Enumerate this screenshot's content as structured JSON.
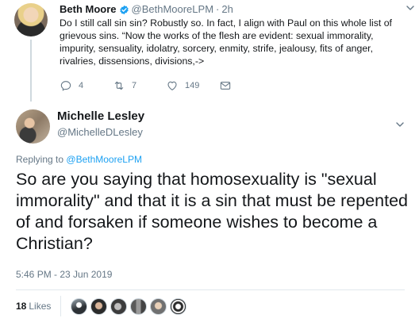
{
  "parent_tweet": {
    "author_name": "Beth Moore",
    "author_handle": "@BethMooreLPM",
    "separator": "·",
    "time": "2h",
    "text": "Do I still call sin sin? Robustly so. In fact, I align with Paul on this whole list of grievous sins. “Now the works of the flesh are evident: sexual immorality, impurity, sensuality, idolatry, sorcery, enmity, strife, jealousy, fits of anger, rivalries, dissensions, divisions,->",
    "actions": {
      "replies": "4",
      "retweets": "7",
      "likes": "149"
    }
  },
  "main_tweet": {
    "author_name": "Michelle Lesley",
    "author_handle": "@MichelleDLesley",
    "replying_prefix": "Replying to",
    "replying_to": "@BethMooreLPM",
    "text": "So are you saying that homosexuality is \"sexual immorality\" and that it is a sin that must be repented of and forsaken if someone wishes to become a Christian?",
    "timestamp": "5:46 PM - 23 Jun 2019",
    "likes_count": "18",
    "likes_label": "Likes"
  },
  "colors": {
    "link": "#1da1f2",
    "secondary_text": "#657786",
    "verified": "#1da1f2",
    "divider": "#e1e8ed"
  },
  "icons": [
    "verified-badge-icon",
    "chevron-down-icon",
    "reply-icon",
    "retweet-icon",
    "like-icon",
    "direct-message-icon"
  ]
}
